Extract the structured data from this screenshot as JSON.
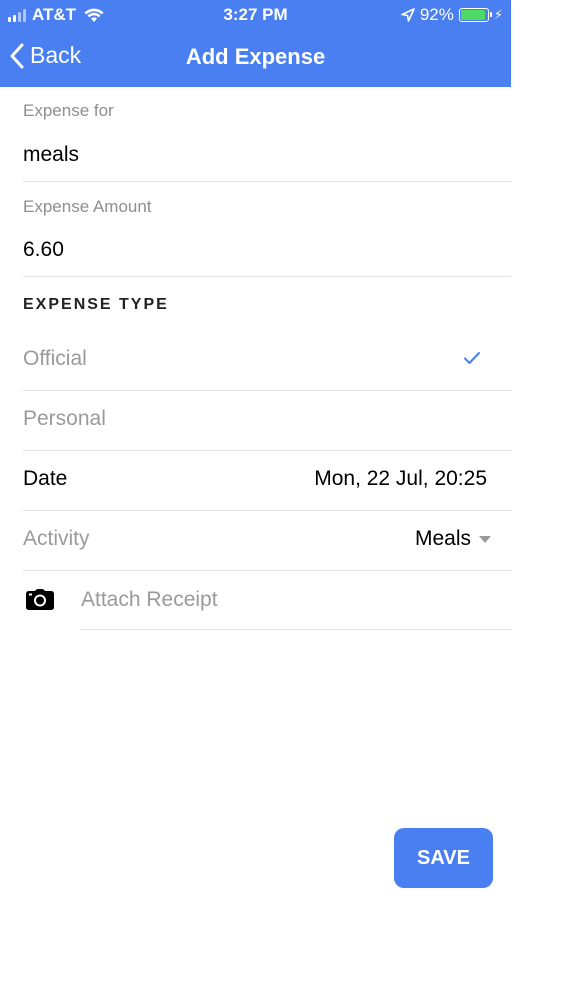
{
  "status_bar": {
    "carrier": "AT&T",
    "time": "3:27 PM",
    "battery_percent": "92%",
    "battery_level": 0.92
  },
  "nav": {
    "back_label": "Back",
    "title": "Add Expense"
  },
  "form": {
    "expense_for": {
      "label": "Expense for",
      "value": "meals"
    },
    "expense_amount": {
      "label": "Expense Amount",
      "value": "6.60"
    },
    "expense_type": {
      "header": "EXPENSE TYPE",
      "options": [
        {
          "label": "Official",
          "selected": true
        },
        {
          "label": "Personal",
          "selected": false
        }
      ]
    },
    "date": {
      "label": "Date",
      "value": "Mon, 22 Jul, 20:25"
    },
    "activity": {
      "label": "Activity",
      "value": "Meals"
    },
    "attach_receipt": {
      "label": "Attach Receipt"
    }
  },
  "save_button": {
    "label": "SAVE"
  },
  "colors": {
    "accent": "#4a7ff2",
    "muted": "#9a9a9e",
    "battery": "#4cd964"
  }
}
